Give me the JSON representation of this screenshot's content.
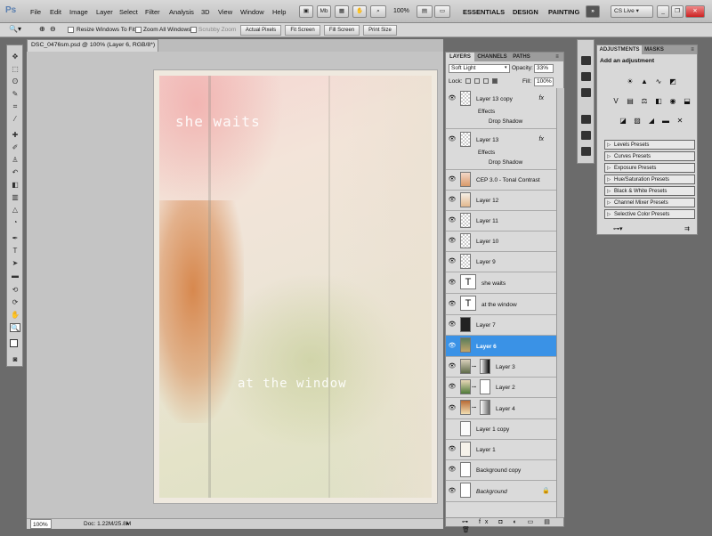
{
  "app": {
    "logo": "Ps"
  },
  "menu": [
    "File",
    "Edit",
    "Image",
    "Layer",
    "Select",
    "Filter",
    "Analysis",
    "3D",
    "View",
    "Window",
    "Help"
  ],
  "menubar": {
    "zoom": "100%",
    "workspaces": [
      "ESSENTIALS",
      "DESIGN",
      "PAINTING"
    ],
    "expand": "»",
    "cs_live": "CS Live ▾"
  },
  "options": {
    "resize_windows": "Resize Windows To Fit",
    "zoom_all": "Zoom All Windows",
    "scrubby": "Scrubby Zoom",
    "actual_pixels": "Actual Pixels",
    "fit_screen": "Fit Screen",
    "fill_screen": "Fill Screen",
    "print_size": "Print Size"
  },
  "document": {
    "tab": "DSC_0476sm.psd @ 100% (Layer 6, RGB/8*) *",
    "text1": "she waits",
    "text2": "at the window"
  },
  "status": {
    "zoom": "100%",
    "doc": "Doc: 1.22M/25.8M"
  },
  "layers_panel": {
    "tabs": [
      "LAYERS",
      "CHANNELS",
      "PATHS"
    ],
    "blend_mode": "Soft Light",
    "opacity_label": "Opacity:",
    "opacity": "33%",
    "lock_label": "Lock:",
    "fill_label": "Fill:",
    "fill": "100%",
    "layers": [
      {
        "name": "Layer 13 copy",
        "fx": "fx",
        "effects": "Effects",
        "effect": "Drop Shadow"
      },
      {
        "name": "Layer 13",
        "fx": "fx",
        "effects": "Effects",
        "effect": "Drop Shadow"
      },
      {
        "name": "CEP 3.0 - Tonal Contrast"
      },
      {
        "name": "Layer 12"
      },
      {
        "name": "Layer 11"
      },
      {
        "name": "Layer 10"
      },
      {
        "name": "Layer 9"
      },
      {
        "name": "she waits",
        "type": "T"
      },
      {
        "name": "at the window",
        "type": "T"
      },
      {
        "name": "Layer 7"
      },
      {
        "name": "Layer 6",
        "selected": true
      },
      {
        "name": "Layer 3"
      },
      {
        "name": "Layer 2"
      },
      {
        "name": "Layer 4"
      },
      {
        "name": "Layer 1 copy"
      },
      {
        "name": "Layer 1"
      },
      {
        "name": "Background copy"
      },
      {
        "name": "Background"
      }
    ],
    "footer": "⊶ fx ◘ ◐ ▭ ▤ 🗑"
  },
  "adjustments": {
    "tabs": [
      "ADJUSTMENTS",
      "MASKS"
    ],
    "title": "Add an adjustment",
    "presets": [
      "Levels Presets",
      "Curves Presets",
      "Exposure Presets",
      "Hue/Saturation Presets",
      "Black & White Presets",
      "Channel Mixer Presets",
      "Selective Color Presets"
    ]
  }
}
